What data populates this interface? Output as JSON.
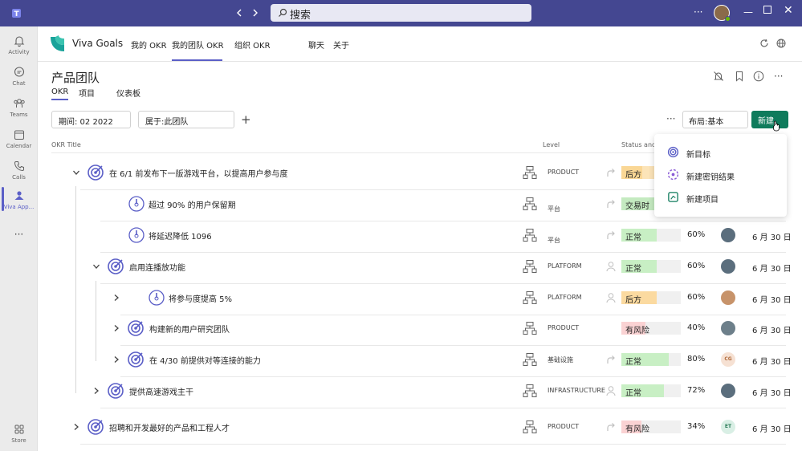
{
  "titlebar": {
    "search_label": "搜索",
    "user_initials": ""
  },
  "rail": [
    {
      "label": "Activity",
      "icon": "bell-icon"
    },
    {
      "label": "Chat",
      "icon": "chat-icon"
    },
    {
      "label": "Teams",
      "icon": "teams-icon"
    },
    {
      "label": "Calendar",
      "icon": "calendar-icon"
    },
    {
      "label": "Calls",
      "icon": "phone-icon"
    },
    {
      "label": "Viva App...",
      "icon": "viva-icon"
    },
    {
      "label": "Store",
      "icon": "store-icon"
    }
  ],
  "appbar": {
    "app_name": "Viva Goals",
    "tabs": [
      "我的 OKR",
      "我的团队 OKR",
      "组织 OKR",
      "聊天",
      "关于"
    ]
  },
  "page": {
    "title": "产品团队",
    "subtabs": [
      "OKR",
      "项目",
      "仪表板"
    ],
    "period_label": "期间: 02 2022",
    "belongs_label": "属于:此团队",
    "layout_label": "布局:基本",
    "new_button": "新建",
    "col_title": "OKR Title",
    "col_level": "Level",
    "col_status": "Status and"
  },
  "menu": [
    "新目标",
    "新建密钥结果",
    "新建项目"
  ],
  "rows": [
    {
      "title": "在 6/1 前发布下一版游戏平台，以提高用户参与度",
      "level": "PRODUCT",
      "status": "后方",
      "status_color": "#fce4b8",
      "fill": "#fad795",
      "progress": 0.35,
      "percent": "",
      "date": "",
      "avatar": ""
    },
    {
      "title": "超过 90% 的用户保留期",
      "level": "平台",
      "status": "交易时",
      "status_color": "#dff6dd",
      "fill": "#c4eac0",
      "progress": 0.6,
      "percent": "",
      "date": "",
      "avatar": ""
    },
    {
      "title": "将延迟降低 1096",
      "level": "平台",
      "status": "正常",
      "status_color": "#f0f0f0",
      "fill": "#c8efc4",
      "progress": 0.6,
      "percent": "60%",
      "date": "6 月 30 日",
      "avatar": "photo"
    },
    {
      "title": "启用连播放功能",
      "level": "PLATFORM",
      "status": "正常",
      "status_color": "#f0f0f0",
      "fill": "#c8efc4",
      "progress": 0.6,
      "percent": "60%",
      "date": "6 月 30 日",
      "avatar": "photo"
    },
    {
      "title": "将参与度提高 5%",
      "level": "PLATFORM",
      "status": "后方",
      "status_color": "#f0f0f0",
      "fill": "#fbdaa0",
      "progress": 0.6,
      "percent": "60%",
      "date": "6 月 30 日",
      "avatar": "photo2"
    },
    {
      "title": "构建新的用户研究团队",
      "level": "PRODUCT",
      "status": "有风险",
      "status_color": "#f0f0f0",
      "fill": "#fad2d3",
      "progress": 0.4,
      "percent": "40%",
      "date": "6 月 30 日",
      "avatar": "photo3"
    },
    {
      "title": "在 4/30 前提供对等连接的能力",
      "level": "基础设施",
      "status": "正常",
      "status_color": "#f0f0f0",
      "fill": "#c8efc4",
      "progress": 0.8,
      "percent": "80%",
      "date": "6 月 30 日",
      "avatar": "CG"
    },
    {
      "title": "提供高速游戏主干",
      "level": "INFRASTRUCTURE",
      "status": "正常",
      "status_color": "#f0f0f0",
      "fill": "#c8efc4",
      "progress": 0.72,
      "percent": "72%",
      "date": "6 月 30 日",
      "avatar": "photo"
    },
    {
      "title": "招聘和开发最好的产品和工程人才",
      "level": "PRODUCT",
      "status": "有风险",
      "status_color": "#f0f0f0",
      "fill": "#fad2d3",
      "progress": 0.34,
      "percent": "34%",
      "date": "6 月 30 日",
      "avatar": "ET"
    }
  ]
}
